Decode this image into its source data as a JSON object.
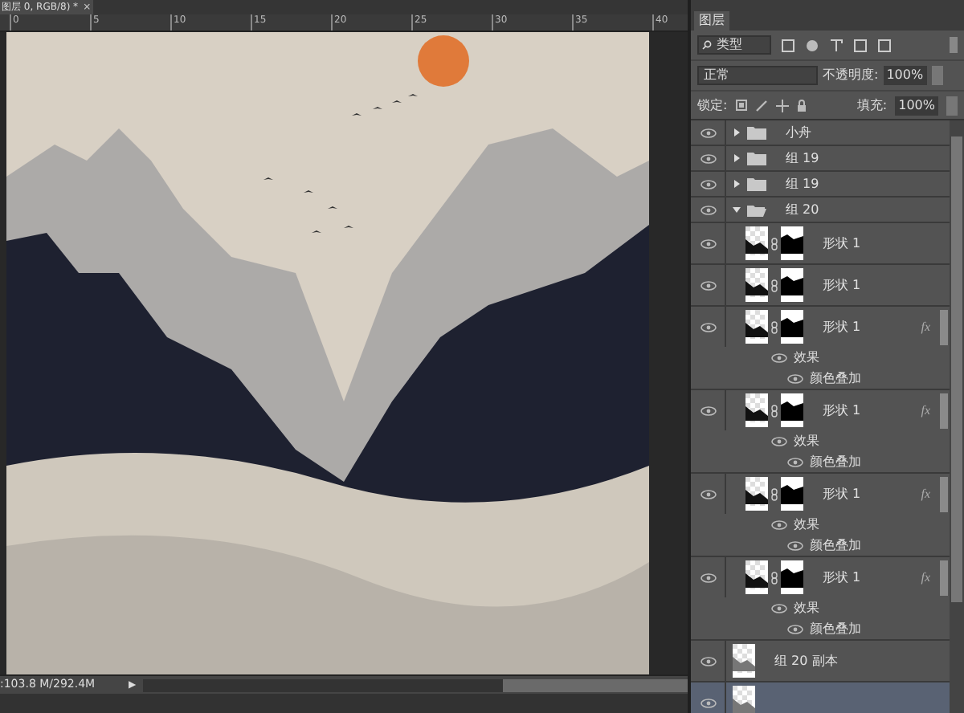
{
  "document_tab": {
    "title": "图层 0, RGB/8) *",
    "close": "×"
  },
  "ruler": {
    "ticks": [
      "0",
      "5",
      "10",
      "15",
      "20",
      "25",
      "30",
      "35",
      "40"
    ]
  },
  "status_bar": {
    "doc_size": ":103.8 M/292.4M",
    "arrow": "▶"
  },
  "layers_panel": {
    "title": "图层",
    "filter": {
      "value": "类型"
    },
    "blend_mode": {
      "value": "正常"
    },
    "opacity": {
      "label": "不透明度:",
      "value": "100%"
    },
    "lock": {
      "label": "锁定:"
    },
    "fill": {
      "label": "填充:",
      "value": "100%"
    },
    "layers": [
      {
        "kind": "group",
        "name": "小舟",
        "visible": true,
        "expanded": false,
        "selected": false
      },
      {
        "kind": "group",
        "name": "组 19",
        "visible": true,
        "expanded": false,
        "selected": false
      },
      {
        "kind": "group",
        "name": "组 19",
        "visible": true,
        "expanded": false,
        "selected": false
      },
      {
        "kind": "group",
        "name": "组 20",
        "visible": true,
        "expanded": true,
        "selected": false,
        "children": [
          {
            "kind": "shape",
            "name": "形状 1",
            "visible": true,
            "selected": false
          },
          {
            "kind": "shape",
            "name": "形状 1",
            "visible": true,
            "selected": false
          },
          {
            "kind": "shape",
            "name": "形状 1",
            "visible": true,
            "selected": false,
            "fx": "fx",
            "effects": {
              "label": "效果",
              "items": [
                "颜色叠加"
              ]
            }
          },
          {
            "kind": "shape",
            "name": "形状 1",
            "visible": true,
            "selected": false,
            "fx": "fx",
            "effects": {
              "label": "效果",
              "items": [
                "颜色叠加"
              ]
            }
          },
          {
            "kind": "shape",
            "name": "形状 1",
            "visible": true,
            "selected": false,
            "fx": "fx",
            "effects": {
              "label": "效果",
              "items": [
                "颜色叠加"
              ]
            }
          },
          {
            "kind": "shape",
            "name": "形状 1",
            "visible": true,
            "selected": false,
            "fx": "fx",
            "effects": {
              "label": "效果",
              "items": [
                "颜色叠加"
              ]
            }
          }
        ]
      },
      {
        "kind": "pixel",
        "name": "组 20 副本",
        "visible": true,
        "selected": false
      },
      {
        "kind": "background",
        "visible": true,
        "selected": true
      }
    ]
  }
}
